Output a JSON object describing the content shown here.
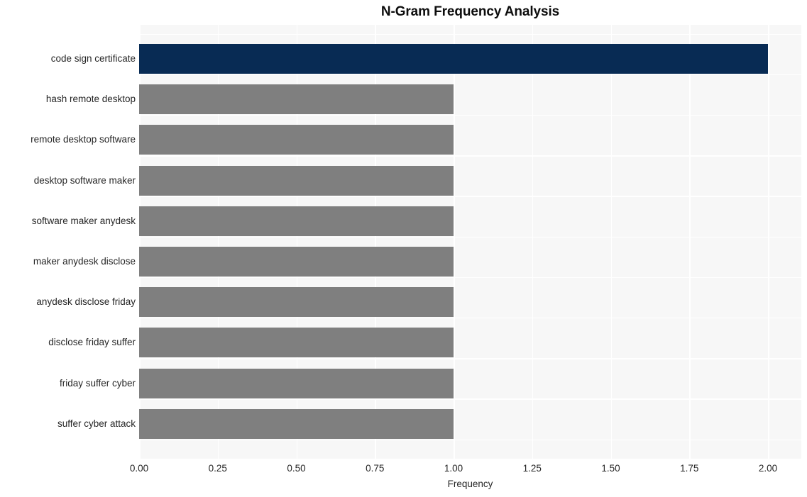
{
  "chart_data": {
    "type": "bar",
    "orientation": "horizontal",
    "title": "N-Gram Frequency Analysis",
    "xlabel": "Frequency",
    "ylabel": "",
    "xlim": [
      0,
      2.0
    ],
    "xticks": [
      "0.00",
      "0.25",
      "0.50",
      "0.75",
      "1.00",
      "1.25",
      "1.50",
      "1.75",
      "2.00"
    ],
    "xtick_values": [
      0,
      0.25,
      0.5,
      0.75,
      1.0,
      1.25,
      1.5,
      1.75,
      2.0
    ],
    "grid": true,
    "legend": null,
    "categories": [
      "code sign certificate",
      "hash remote desktop",
      "remote desktop software",
      "desktop software maker",
      "software maker anydesk",
      "maker anydesk disclose",
      "anydesk disclose friday",
      "disclose friday suffer",
      "friday suffer cyber",
      "suffer cyber attack"
    ],
    "values": [
      2,
      1,
      1,
      1,
      1,
      1,
      1,
      1,
      1,
      1
    ],
    "bar_colors": [
      "#082b54",
      "#7f7f7f",
      "#7f7f7f",
      "#7f7f7f",
      "#7f7f7f",
      "#7f7f7f",
      "#7f7f7f",
      "#7f7f7f",
      "#7f7f7f",
      "#7f7f7f"
    ]
  },
  "style": {
    "plot_background": "#f7f7f7",
    "figure_background": "#ffffff",
    "grid_color": "#ffffff",
    "text_color": "#262626",
    "title_color": "#0d0d0d",
    "highlight_color": "#082b54",
    "bar_color": "#7f7f7f"
  }
}
